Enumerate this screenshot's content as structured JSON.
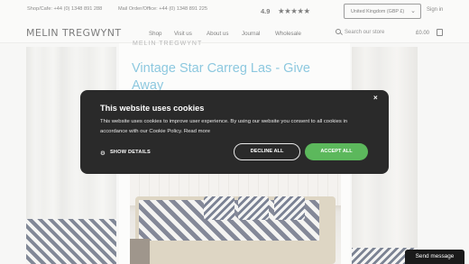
{
  "topbar": {
    "shop_phone": "Shop/Cafe: +44 (0) 1348 891 288",
    "office_phone": "Mail Order/Office: +44 (0) 1348 891 225",
    "rating": "4.9",
    "stars": "★★★★★",
    "country": "United Kingdom (GBP £)",
    "signin": "Sign in"
  },
  "header": {
    "logo": "MELIN TREGWYNT",
    "nav": [
      "Shop",
      "Visit us",
      "About us",
      "Journal",
      "Wholesale"
    ],
    "search_placeholder": "Search our store",
    "cart_total": "£0.00"
  },
  "article": {
    "brand": "MELIN TREGWYNT",
    "title": "Vintage Star Carreg Las - Give Away"
  },
  "cookie_modal": {
    "heading": "This website uses cookies",
    "body": "This website uses cookies to improve user experience. By using our website you consent to all cookies in accordance with our Cookie Policy. Read more",
    "show_details": "SHOW DETAILS",
    "decline": "DECLINE ALL",
    "accept": "ACCEPT ALL",
    "close": "×",
    "accent_color": "#5cb85c"
  },
  "chat": {
    "label": "Send message"
  }
}
